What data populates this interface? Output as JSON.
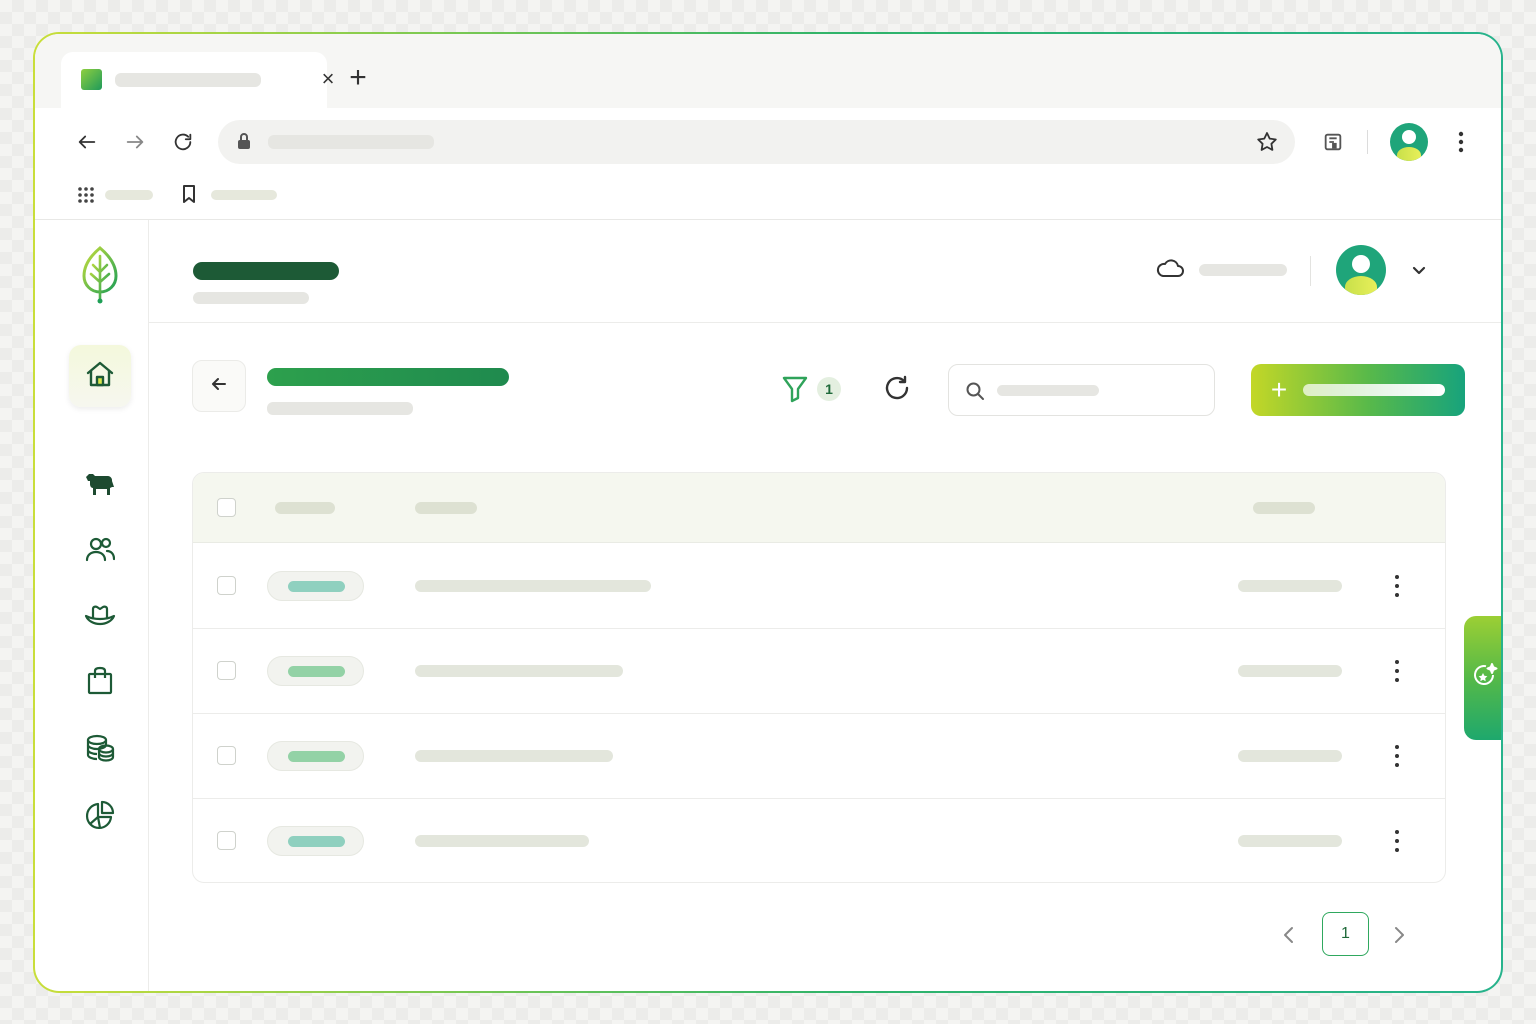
{
  "browser": {
    "tab": {
      "close_glyph": "×",
      "favicon": "app-favicon"
    },
    "new_tab_glyph": "+",
    "toolbar_icons": [
      "back-icon",
      "forward-icon",
      "reload-icon",
      "lock-icon",
      "star-icon",
      "reading-list-icon",
      "profile-avatar",
      "more-icon"
    ],
    "bookmarks_icons": [
      "apps-icon",
      "bookmark-icon"
    ]
  },
  "sidebar": {
    "items": [
      {
        "name": "home",
        "icon": "home-icon",
        "active": true
      },
      {
        "name": "cattle",
        "icon": "cow-icon"
      },
      {
        "name": "people",
        "icon": "users-icon"
      },
      {
        "name": "ranch",
        "icon": "cowboy-hat-icon"
      },
      {
        "name": "shop",
        "icon": "bag-icon"
      },
      {
        "name": "finance",
        "icon": "coins-icon"
      },
      {
        "name": "reports",
        "icon": "pie-chart-icon"
      }
    ]
  },
  "toolbar": {
    "filter_count": "1",
    "add_glyph": "+"
  },
  "table": {
    "rows": [
      {
        "pill_color": "#8fd0bf",
        "main_width": 236
      },
      {
        "pill_color": "#93d2a6",
        "main_width": 208
      },
      {
        "pill_color": "#93d2a6",
        "main_width": 198
      },
      {
        "pill_color": "#8fd0bf",
        "main_width": 174
      }
    ]
  },
  "pagination": {
    "current_page": "1"
  },
  "colors": {
    "brand_dark": "#1d5a36",
    "brand_green": "#2da04d",
    "accent_lime": "#c3d727",
    "accent_teal": "#17a37c"
  }
}
